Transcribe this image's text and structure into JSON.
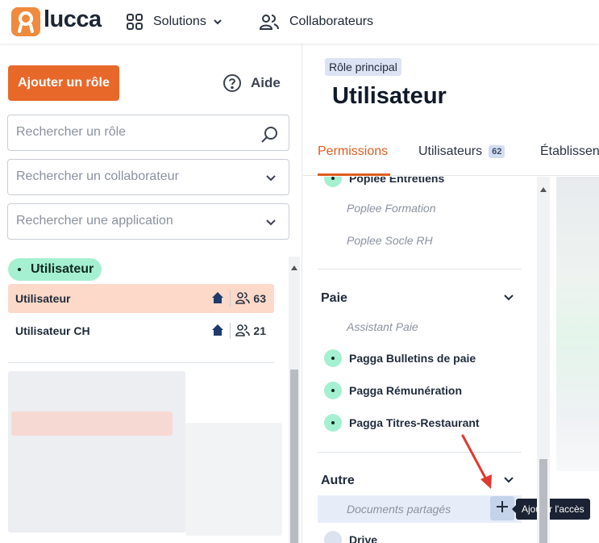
{
  "app": {
    "brand": "lucca",
    "nav": {
      "solutions_label": "Solutions",
      "collaborateurs_label": "Collaborateurs"
    }
  },
  "sidebar": {
    "add_role_label": "Ajouter un rôle",
    "help_label": "Aide",
    "search_role_placeholder": "Rechercher un rôle",
    "search_collaborator_placeholder": "Rechercher un collaborateur",
    "search_application_placeholder": "Rechercher une application",
    "group_chip_label": "Utilisateur",
    "roles": [
      {
        "name": "Utilisateur",
        "count": "63",
        "selected": true
      },
      {
        "name": "Utilisateur CH",
        "count": "21",
        "selected": false
      }
    ]
  },
  "main": {
    "role_tag": "Rôle principal",
    "role_title": "Utilisateur",
    "tabs": [
      {
        "label": "Permissions",
        "active": true
      },
      {
        "label": "Utilisateurs",
        "badge": "62"
      },
      {
        "label": "Établissen"
      }
    ],
    "permissions": {
      "top_cut_item": "Poplee Entretiens",
      "disabled_items_top": [
        "Poplee Formation",
        "Poplee Socle RH"
      ],
      "sections": [
        {
          "title": "Paie",
          "disabled_items": [
            "Assistant Paie"
          ],
          "enabled_items": [
            "Pagga Bulletins de paie",
            "Pagga Rémunération",
            "Pagga Titres-Restaurant"
          ]
        },
        {
          "title": "Autre",
          "disabled_items": [
            "Documents partagés"
          ],
          "enabled_items": [
            "Drive"
          ]
        }
      ],
      "add_access_tooltip": "Ajouter l'accès"
    }
  },
  "colors": {
    "accent": "#e8682a",
    "active_tab": "#e05d1f",
    "green_dot": "#a6f0d2",
    "selected_row": "#fcd9c9",
    "tooltip_bg": "#1a2233",
    "annotation_arrow": "#e03a2f"
  }
}
